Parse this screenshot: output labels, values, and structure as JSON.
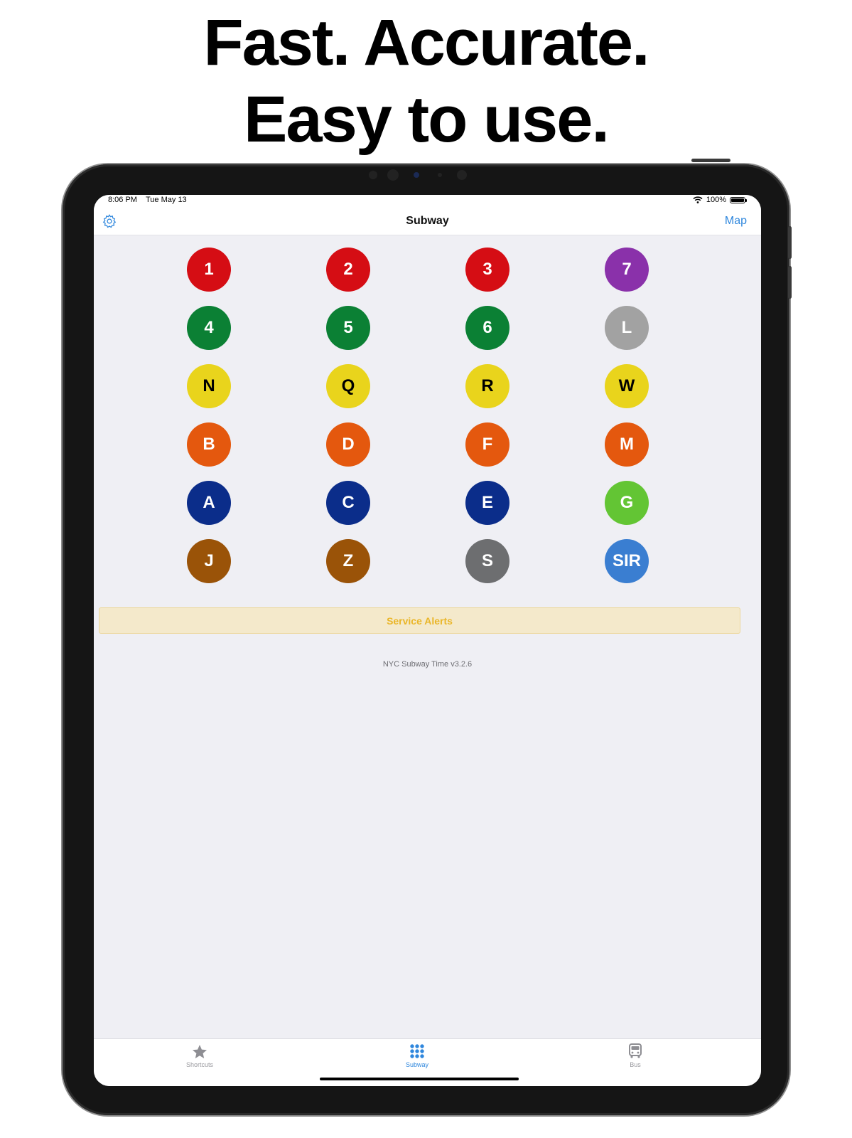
{
  "headline": {
    "line1": "Fast. Accurate.",
    "line2": "Easy to use."
  },
  "statusbar": {
    "time": "8:06 PM",
    "date": "Tue May 13",
    "battery": "100%",
    "battery_level": 1.0
  },
  "navbar": {
    "title": "Subway",
    "map_label": "Map",
    "settings_icon": "gear-icon"
  },
  "lines": [
    {
      "label": "1",
      "color": "#d50d14",
      "text_color": "#ffffff"
    },
    {
      "label": "2",
      "color": "#d50d14",
      "text_color": "#ffffff"
    },
    {
      "label": "3",
      "color": "#d50d14",
      "text_color": "#ffffff"
    },
    {
      "label": "7",
      "color": "#8a31aa",
      "text_color": "#ffffff"
    },
    {
      "label": "4",
      "color": "#0b8034",
      "text_color": "#ffffff"
    },
    {
      "label": "5",
      "color": "#0b8034",
      "text_color": "#ffffff"
    },
    {
      "label": "6",
      "color": "#0b8034",
      "text_color": "#ffffff"
    },
    {
      "label": "L",
      "color": "#a2a2a2",
      "text_color": "#ffffff"
    },
    {
      "label": "N",
      "color": "#e9d41c",
      "text_color": "#000000"
    },
    {
      "label": "Q",
      "color": "#e9d41c",
      "text_color": "#000000"
    },
    {
      "label": "R",
      "color": "#e9d41c",
      "text_color": "#000000"
    },
    {
      "label": "W",
      "color": "#e9d41c",
      "text_color": "#000000"
    },
    {
      "label": "B",
      "color": "#e4580e",
      "text_color": "#ffffff"
    },
    {
      "label": "D",
      "color": "#e4580e",
      "text_color": "#ffffff"
    },
    {
      "label": "F",
      "color": "#e4580e",
      "text_color": "#ffffff"
    },
    {
      "label": "M",
      "color": "#e4580e",
      "text_color": "#ffffff"
    },
    {
      "label": "A",
      "color": "#0b2d8a",
      "text_color": "#ffffff"
    },
    {
      "label": "C",
      "color": "#0b2d8a",
      "text_color": "#ffffff"
    },
    {
      "label": "E",
      "color": "#0b2d8a",
      "text_color": "#ffffff"
    },
    {
      "label": "G",
      "color": "#63c534",
      "text_color": "#ffffff"
    },
    {
      "label": "J",
      "color": "#9a5308",
      "text_color": "#ffffff"
    },
    {
      "label": "Z",
      "color": "#9a5308",
      "text_color": "#ffffff"
    },
    {
      "label": "S",
      "color": "#6d6e70",
      "text_color": "#ffffff"
    },
    {
      "label": "SIR",
      "color": "#3a7ed1",
      "text_color": "#ffffff"
    }
  ],
  "service_alerts": {
    "label": "Service Alerts"
  },
  "version_text": "NYC Subway Time v3.2.6",
  "tabs": [
    {
      "label": "Shortcuts",
      "icon": "star-icon",
      "active": false
    },
    {
      "label": "Subway",
      "icon": "grid-dots-icon",
      "active": true
    },
    {
      "label": "Bus",
      "icon": "bus-icon",
      "active": false
    }
  ],
  "colors": {
    "accent": "#2f87dd",
    "alert_text": "#eab629",
    "alert_bg": "#f4e9cb",
    "screen_bg": "#efeff4"
  }
}
